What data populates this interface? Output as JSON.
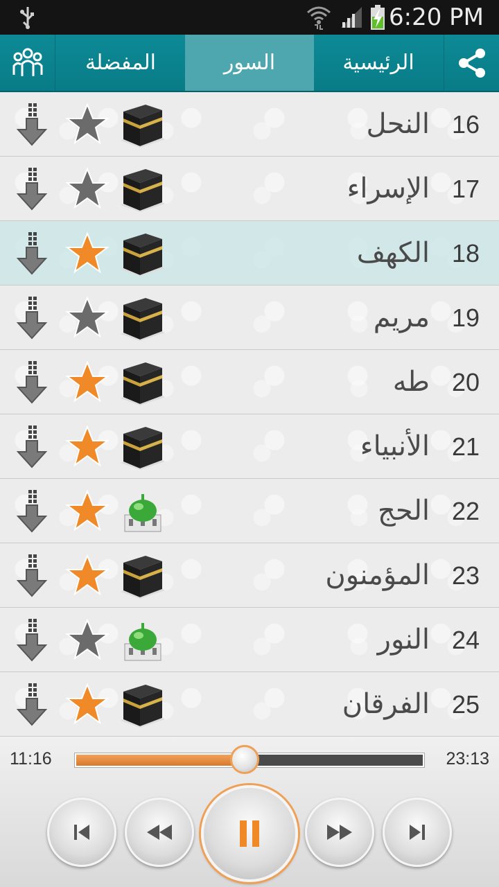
{
  "status_bar": {
    "time": "6:20 PM",
    "icons": [
      "usb-icon",
      "wifi-icon",
      "signal-icon",
      "battery-charging-icon"
    ]
  },
  "tabs": {
    "left_icon": "group-icon",
    "right_icon": "share-icon",
    "favorites_label": "المفضلة",
    "surahs_label": "السور",
    "home_label": "الرئيسية",
    "active": "surahs"
  },
  "surahs": [
    {
      "number": "16",
      "name": "النحل",
      "favorite": false,
      "place": "kaaba"
    },
    {
      "number": "17",
      "name": "الإسراء",
      "favorite": false,
      "place": "kaaba"
    },
    {
      "number": "18",
      "name": "الكهف",
      "favorite": true,
      "place": "kaaba",
      "active": true
    },
    {
      "number": "19",
      "name": "مريم",
      "favorite": false,
      "place": "kaaba"
    },
    {
      "number": "20",
      "name": "طه",
      "favorite": true,
      "place": "kaaba"
    },
    {
      "number": "21",
      "name": "الأنبياء",
      "favorite": true,
      "place": "kaaba"
    },
    {
      "number": "22",
      "name": "الحج",
      "favorite": true,
      "place": "mosque"
    },
    {
      "number": "23",
      "name": "المؤمنون",
      "favorite": true,
      "place": "kaaba"
    },
    {
      "number": "24",
      "name": "النور",
      "favorite": false,
      "place": "mosque"
    },
    {
      "number": "25",
      "name": "الفرقان",
      "favorite": true,
      "place": "kaaba"
    }
  ],
  "player": {
    "current_time": "11:16",
    "total_time": "23:13",
    "progress": 0.486,
    "accent": "#f0a055",
    "state": "playing"
  },
  "colors": {
    "tabbar": "#0b8590",
    "tab_active": "#4ea7ae",
    "star_on": "#f08a28",
    "star_off": "#6b6b6b"
  }
}
